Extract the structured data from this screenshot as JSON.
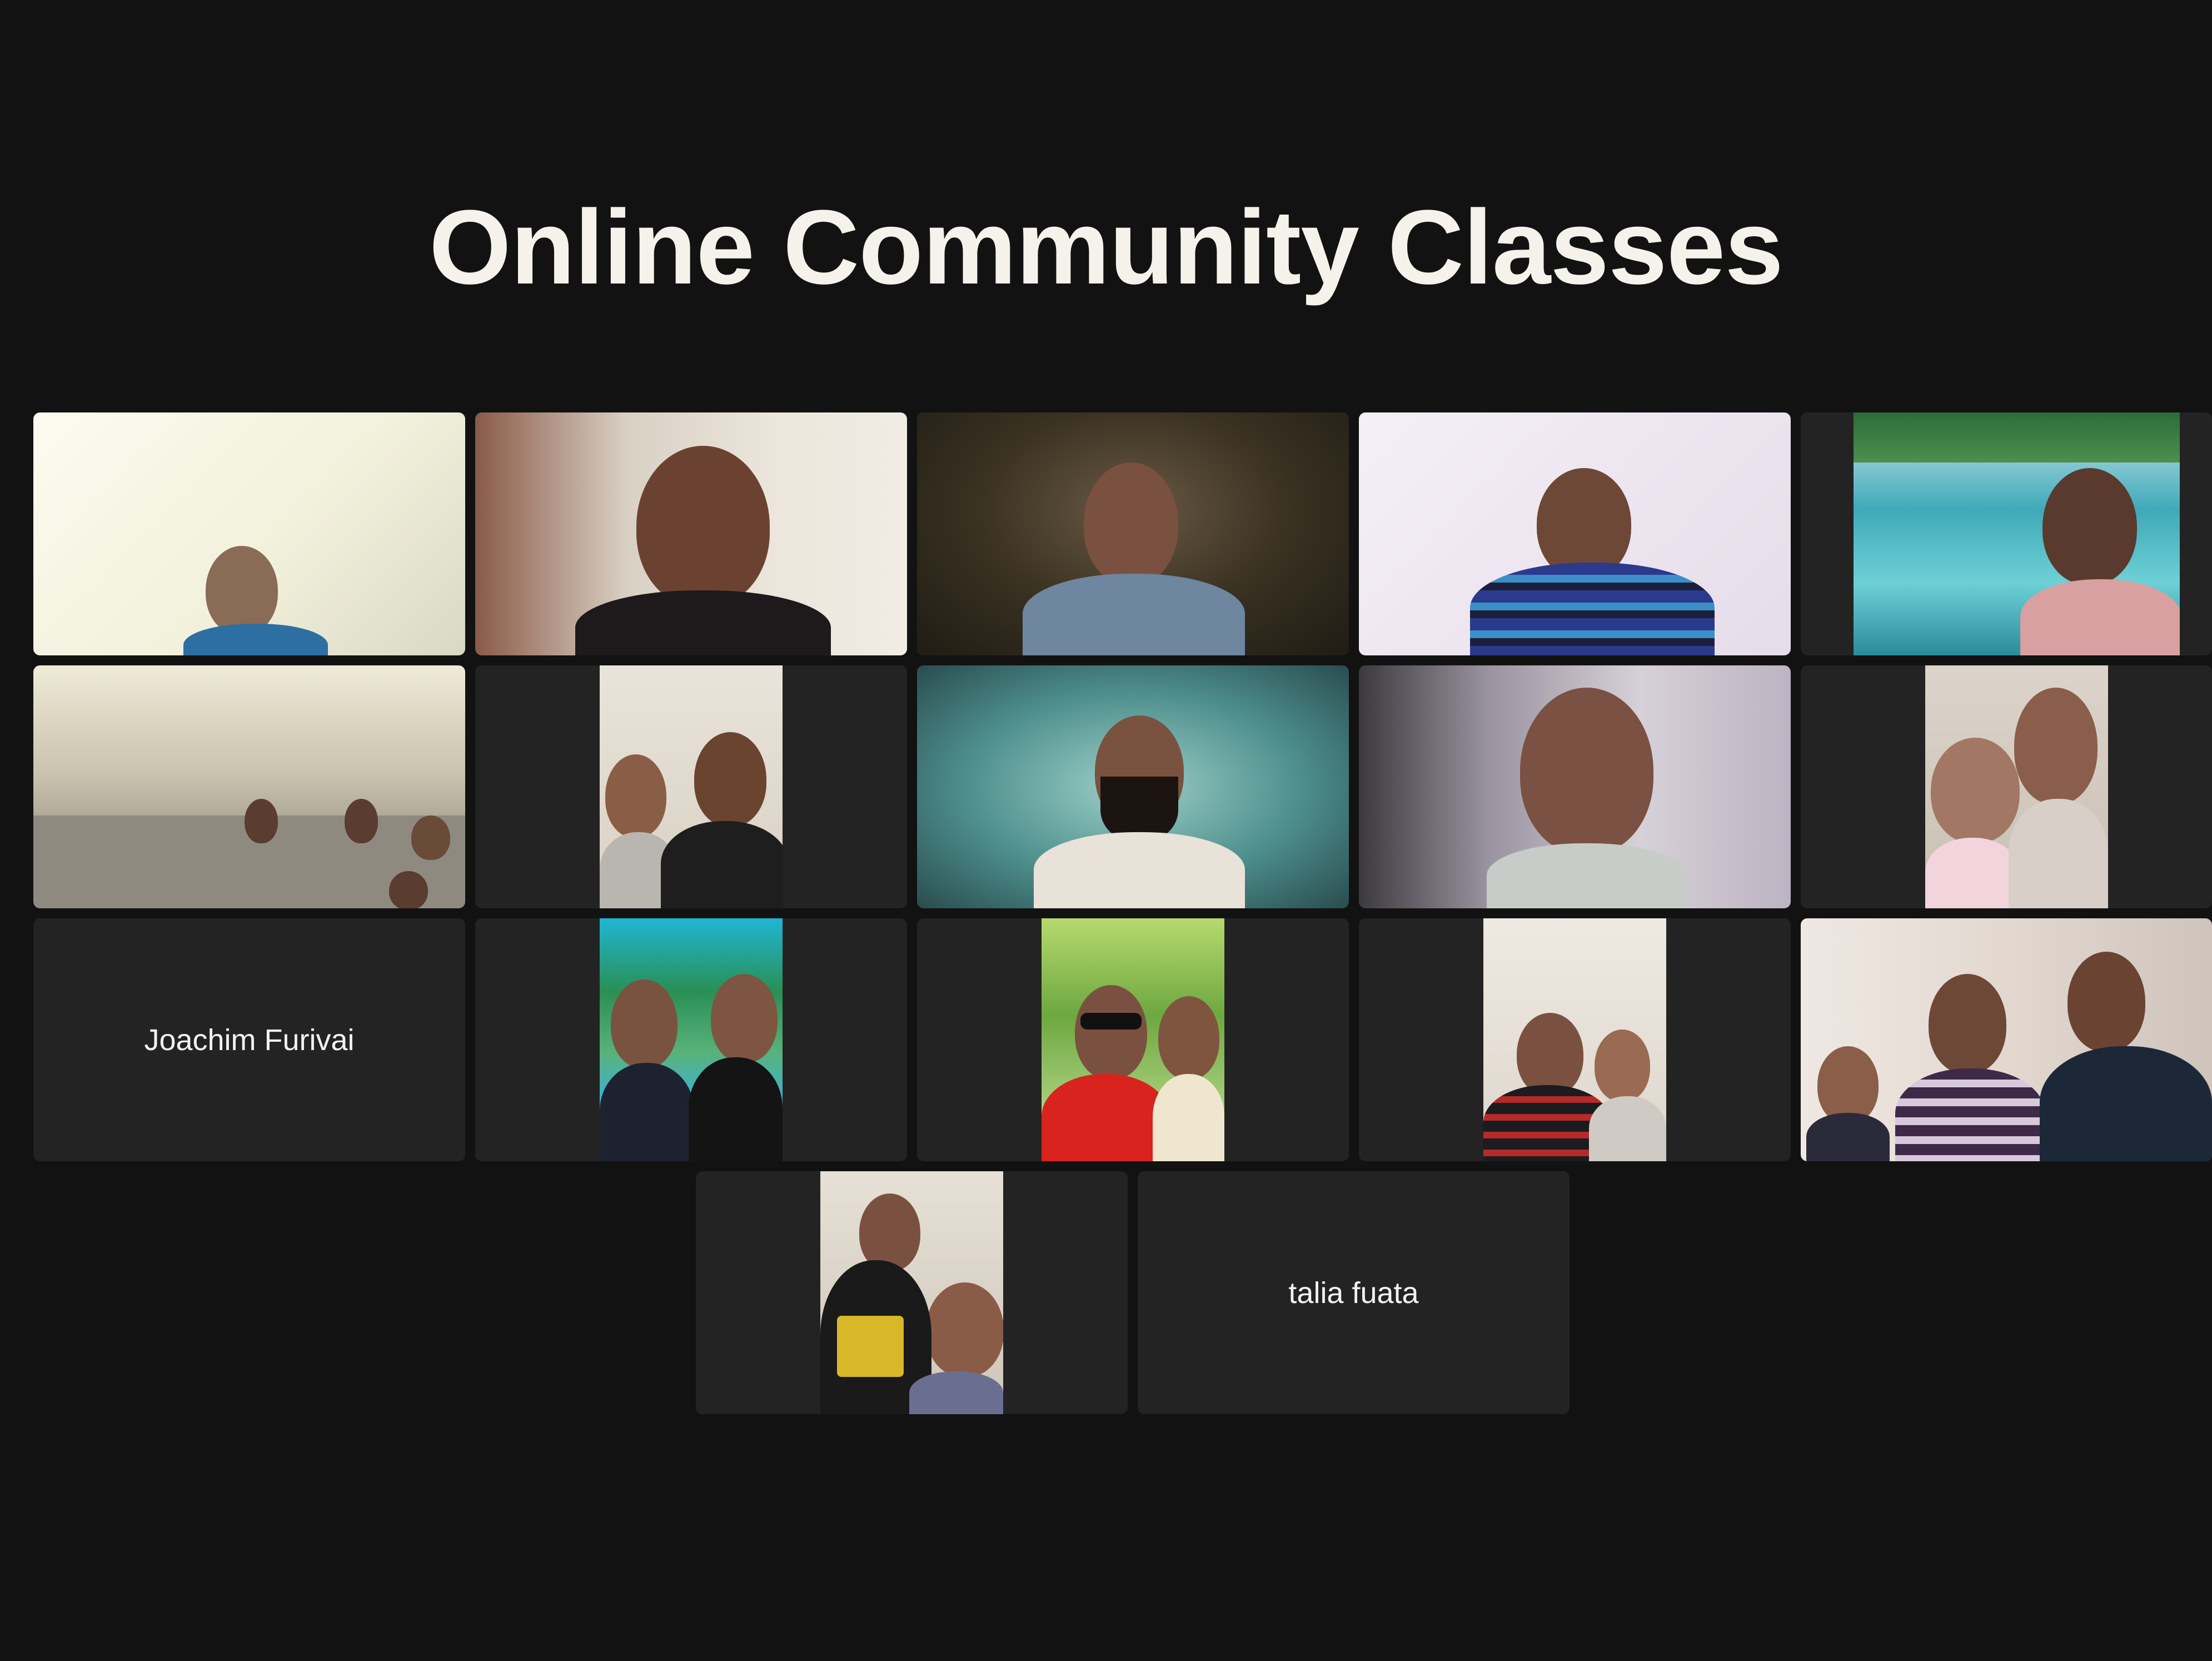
{
  "meeting": {
    "title": "Online Community Classes",
    "active_speaker_color": "#2fd44f"
  },
  "participants": [
    {
      "position": "row1-col1",
      "video": "camera-on"
    },
    {
      "position": "row1-col2",
      "video": "camera-on"
    },
    {
      "position": "row1-col3",
      "video": "camera-on",
      "active_speaker": true
    },
    {
      "position": "row1-col4",
      "video": "camera-on"
    },
    {
      "position": "row1-col5",
      "video": "camera-on"
    },
    {
      "position": "row2-col1",
      "video": "camera-on"
    },
    {
      "position": "row2-col2",
      "video": "camera-on"
    },
    {
      "position": "row2-col3",
      "video": "camera-on"
    },
    {
      "position": "row2-col4",
      "video": "camera-on"
    },
    {
      "position": "row2-col5",
      "video": "camera-on"
    },
    {
      "position": "row3-col1",
      "video": "camera-off",
      "name": "Joachim Furivai"
    },
    {
      "position": "row3-col2",
      "video": "camera-on"
    },
    {
      "position": "row3-col3",
      "video": "camera-on"
    },
    {
      "position": "row3-col4",
      "video": "camera-on"
    },
    {
      "position": "row3-col5",
      "video": "camera-on"
    },
    {
      "position": "row4-col1",
      "video": "camera-on"
    },
    {
      "position": "row4-col2",
      "video": "camera-off",
      "name": "talia fuata"
    }
  ]
}
